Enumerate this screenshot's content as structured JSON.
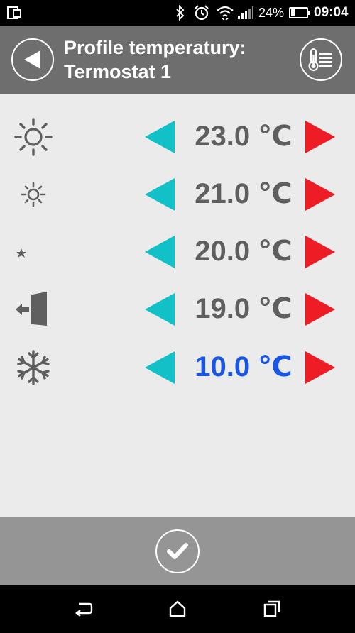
{
  "status_bar": {
    "battery_percent": "24%",
    "time": "09:04",
    "icons": [
      "screen-mirror-icon",
      "bluetooth-icon",
      "alarm-icon",
      "wifi-icon",
      "signal-icon",
      "battery-icon"
    ]
  },
  "header": {
    "title_line1": "Profile temperatury:",
    "title_line2": "Termostat 1",
    "back_icon": "back-arrow-icon",
    "menu_icon": "thermometer-list-icon"
  },
  "profiles": [
    {
      "icon": "sun-large-icon",
      "value": "23.0 ℃",
      "color": "#5f5f5f"
    },
    {
      "icon": "sun-small-icon",
      "value": "21.0 ℃",
      "color": "#5f5f5f"
    },
    {
      "icon": "moon-star-icon",
      "value": "20.0 ℃",
      "color": "#5f5f5f"
    },
    {
      "icon": "exit-door-icon",
      "value": "19.0 ℃",
      "color": "#5f5f5f"
    },
    {
      "icon": "snowflake-icon",
      "value": "10.0 ℃",
      "color": "#1a56e6"
    }
  ],
  "colors": {
    "decrease_arrow": "#12c0c8",
    "increase_arrow": "#ee1c25",
    "header_bg": "#6e6e6e",
    "bottom_bar_bg": "#959595",
    "content_bg": "#ebebeb"
  },
  "bottom_bar": {
    "confirm_icon": "checkmark-icon"
  },
  "nav_bar": {
    "icons": [
      "back-nav-icon",
      "home-icon",
      "recents-icon"
    ]
  }
}
